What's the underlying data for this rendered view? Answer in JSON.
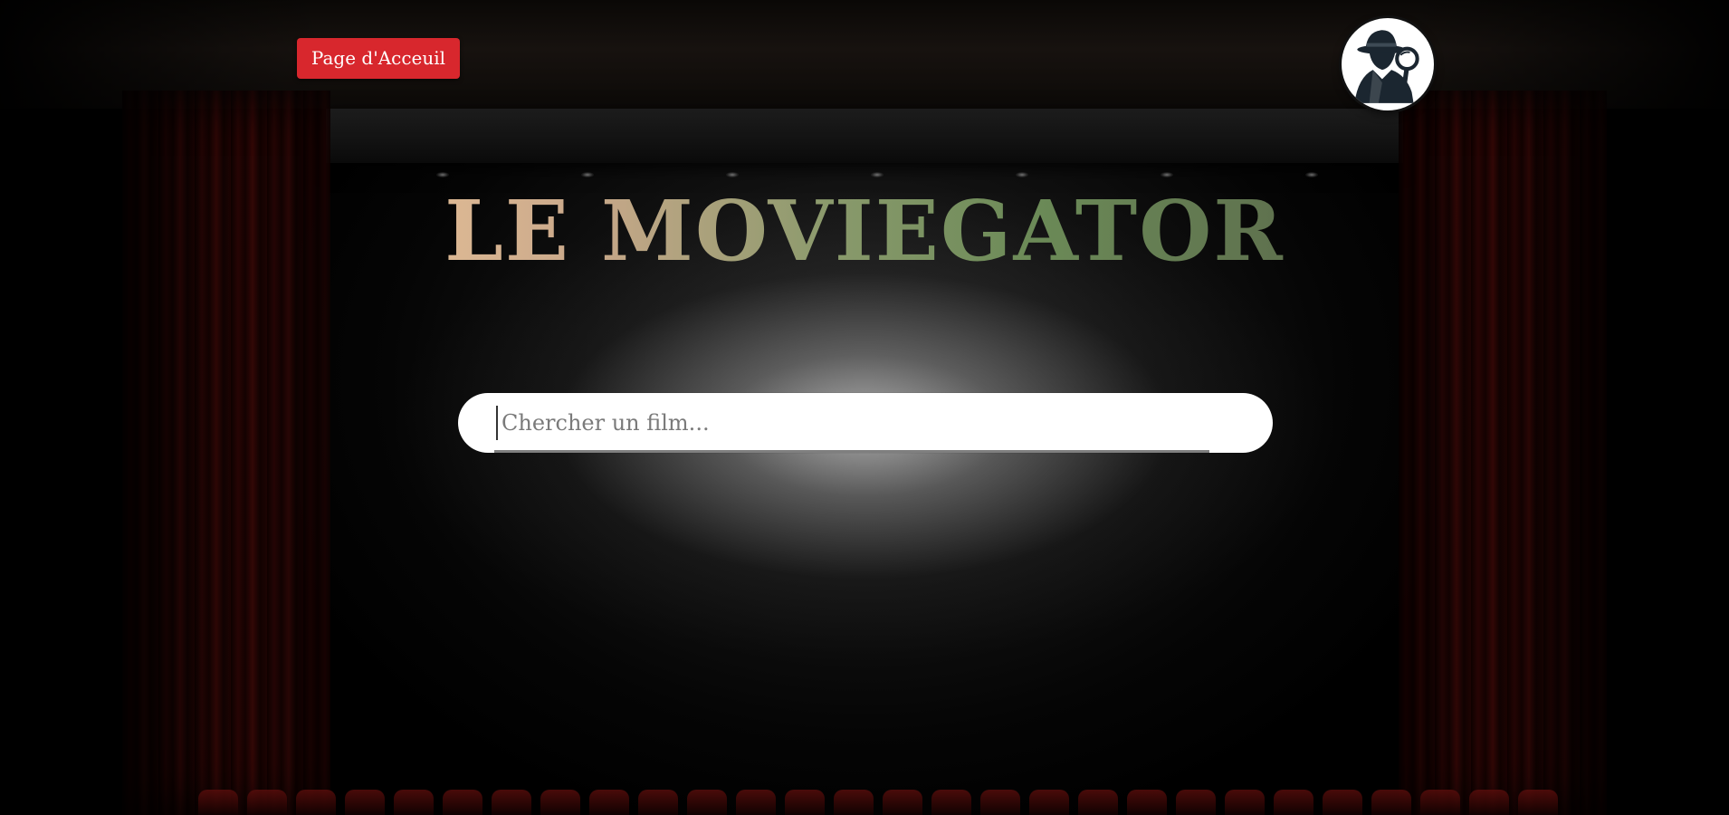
{
  "header": {
    "home_button_label": "Page d'Acceuil",
    "logo_icon": "detective-magnifier-icon"
  },
  "hero": {
    "title": "LE MOVIEGATOR"
  },
  "search": {
    "placeholder": "Chercher un film...",
    "value": ""
  },
  "theme": {
    "accent": "#d8272d",
    "background": "#000000"
  }
}
